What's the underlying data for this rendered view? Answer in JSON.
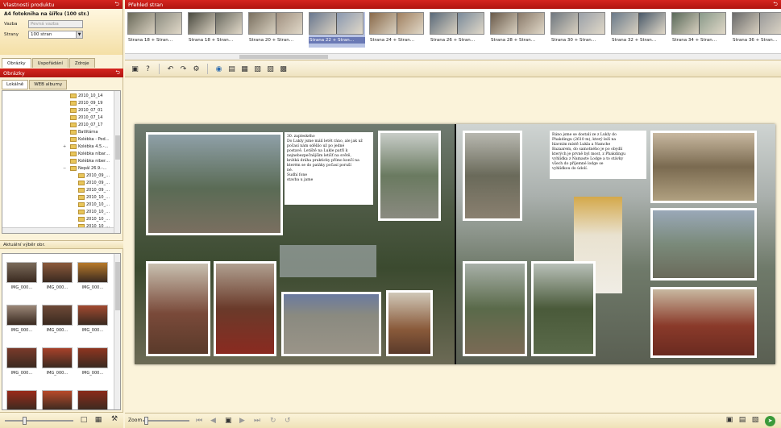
{
  "left": {
    "product_header": "Vlastnosti produktu",
    "product_title": "A4 fotokniha na šířku (100 str.)",
    "fields": [
      {
        "label": "Vazba",
        "value": "Pevná vazba",
        "disabled": true
      },
      {
        "label": "Strany",
        "value": "100 stran",
        "disabled": false
      }
    ],
    "tabs": [
      {
        "label": "Obrázky",
        "active": true
      },
      {
        "label": "Uspořádání",
        "active": false
      },
      {
        "label": "Zdroje",
        "active": false
      }
    ],
    "folders_header": "Obrázky",
    "source_tabs": [
      {
        "label": "Lokálně",
        "active": true
      },
      {
        "label": "WEB albumy",
        "active": false
      }
    ],
    "tree_items": [
      {
        "label": "2010_10_14",
        "expander": ""
      },
      {
        "label": "2010_09_19",
        "expander": ""
      },
      {
        "label": "2010_07_01",
        "expander": ""
      },
      {
        "label": "2010_07_14",
        "expander": ""
      },
      {
        "label": "2010_07_17",
        "expander": ""
      },
      {
        "label": "Batlitárna",
        "expander": ""
      },
      {
        "label": "Kolébka - Pod…",
        "expander": ""
      },
      {
        "label": "Kolébka 4.5.-…",
        "expander": "+"
      },
      {
        "label": "Kolébka níbar…",
        "expander": ""
      },
      {
        "label": "Kolébka niber…",
        "expander": ""
      },
      {
        "label": "Nepál 26.9.-…",
        "expander": "−"
      },
      {
        "label": "2010_09_…",
        "expander": ""
      },
      {
        "label": "2010_09_…",
        "expander": ""
      },
      {
        "label": "2010_09_…",
        "expander": ""
      },
      {
        "label": "2010_10_…",
        "expander": ""
      },
      {
        "label": "2010_10_…",
        "expander": ""
      },
      {
        "label": "2010_10_…",
        "expander": ""
      },
      {
        "label": "2010_10_…",
        "expander": ""
      },
      {
        "label": "2010_10_…",
        "expander": ""
      }
    ],
    "images_header": "Aktuální výběr obr.",
    "images": [
      {
        "caption": "IMG_000…",
        "color": "#7a6a5a"
      },
      {
        "caption": "IMG_000…",
        "color": "#8c5a3c"
      },
      {
        "caption": "IMG_000…",
        "color": "#b87a2a"
      },
      {
        "caption": "IMG_000…",
        "color": "#9b8778"
      },
      {
        "caption": "IMG_000…",
        "color": "#6e4a38"
      },
      {
        "caption": "IMG_000…",
        "color": "#a24a30"
      },
      {
        "caption": "IMG_000…",
        "color": "#7a3a2a"
      },
      {
        "caption": "IMG_000…",
        "color": "#a8422a"
      },
      {
        "caption": "IMG_000…",
        "color": "#8e3520"
      },
      {
        "caption": "",
        "color": "#9a2a1a"
      },
      {
        "caption": "",
        "color": "#b84a2a"
      },
      {
        "caption": "",
        "color": "#8a2a1a"
      }
    ]
  },
  "pages": {
    "header": "Přehled stran",
    "items": [
      {
        "label": "Strana 18 + Stran…",
        "colors": [
          "#6a6a5a",
          "#8c8c80"
        ],
        "selected": false
      },
      {
        "label": "Strana 18 + Stran…",
        "colors": [
          "#4a4a40",
          "#6a6a60"
        ],
        "selected": false
      },
      {
        "label": "Strana 20 + Stran…",
        "colors": [
          "#7a7060",
          "#a09080"
        ],
        "selected": false
      },
      {
        "label": "Strana 22 + Stran…",
        "colors": [
          "#6a7890",
          "#8a98b0"
        ],
        "selected": true
      },
      {
        "label": "Strana 24 + Stran…",
        "colors": [
          "#8a6a4a",
          "#a08060"
        ],
        "selected": false
      },
      {
        "label": "Strana 26 + Stran…",
        "colors": [
          "#5a6a7a",
          "#7a8a9a"
        ],
        "selected": false
      },
      {
        "label": "Strana 28 + Stran…",
        "colors": [
          "#6a5a4a",
          "#8a7a6a"
        ],
        "selected": false
      },
      {
        "label": "Strana 30 + Stran…",
        "colors": [
          "#707880",
          "#9aa0a8"
        ],
        "selected": false
      },
      {
        "label": "Strana 32 + Stran…",
        "colors": [
          "#6a7a8a",
          "#4a5a6a"
        ],
        "selected": false
      },
      {
        "label": "Strana 34 + Stran…",
        "colors": [
          "#5a6a5a",
          "#8a9a8a"
        ],
        "selected": false
      },
      {
        "label": "Strana 36 + Stran…",
        "colors": [
          "#6a6a6a",
          "#9a9a9a"
        ],
        "selected": false
      }
    ]
  },
  "toolbar": {
    "buttons": [
      "▣",
      "?",
      "↶",
      "↷",
      "⚙",
      "◉",
      "☰",
      "▤",
      "▦",
      "▧",
      "▨",
      "▩"
    ]
  },
  "book": {
    "left_text": "30. zapleského\nDo Lukly jsme málí letět ráno, ale jak už\npočasí nám sdělilo už po jedné\npostavě. Letiště na Lukle patří k\nnejnebezpečnějším letišť na světě,\nkrátká dráha prakticky přímo končí na\nkterém se do patáky počasí poruší\nné.\nSudhí fone\nstavba u jame",
    "right_text": "Ráno jsme se dostali ze z Lukly do\nPhakdingu (2610 m), který leží na\nhlavním místě Lukla a Namche\nBazaarem, do samotného je po obydlí\nkterých je prvně byl most, z Phakdingu\nvyhlídka z Namaste Lodge a to stávky\nvšech do příjemné lodge se\nvyhlídkou do údolí."
  },
  "statusbar": {
    "zoom_label": "Zoom",
    "nav": [
      "⏮",
      "◀",
      "▶",
      "⏭",
      "↻",
      "↺"
    ]
  }
}
